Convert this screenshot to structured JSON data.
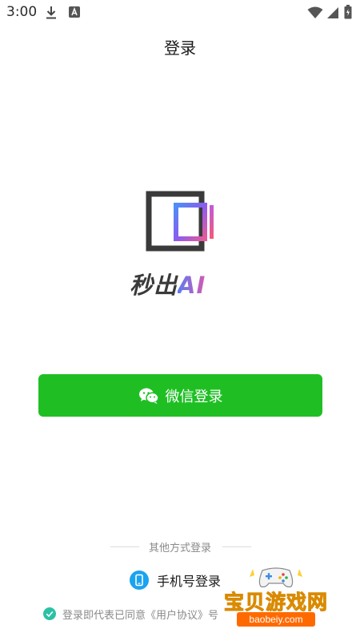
{
  "status_bar": {
    "time": "3:00",
    "icons": [
      "download-icon",
      "app-notification-icon",
      "wifi-icon",
      "signal-icon",
      "battery-icon"
    ]
  },
  "header": {
    "title": "登录"
  },
  "logo": {
    "brand_cn": "秒出",
    "brand_ai": "AI",
    "colors": {
      "frame": "#3a3a3a",
      "gradient_start": "#5b7cf0",
      "gradient_end": "#d65ab0"
    }
  },
  "wechat_login": {
    "label": "微信登录",
    "icon": "wechat-icon",
    "color": "#1fbf24"
  },
  "other_methods": {
    "label": "其他方式登录"
  },
  "phone_login": {
    "label": "手机号登录",
    "icon": "phone-icon",
    "color": "#1aa3f0"
  },
  "agreement": {
    "prefix": "登录即代表已同意",
    "user_agreement": "《用户协议》",
    "suffix": "号",
    "checked": true,
    "check_color": "#2cc1a7"
  },
  "watermark": {
    "title": "宝贝游戏网",
    "url": "baobeiy.com"
  }
}
